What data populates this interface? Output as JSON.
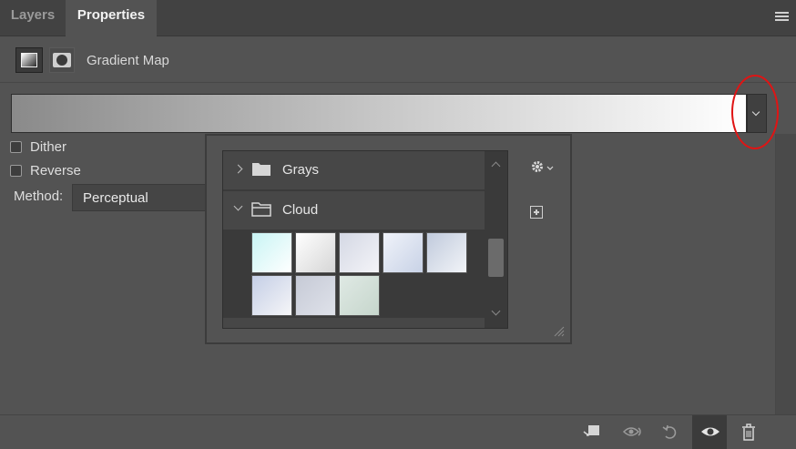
{
  "tabs": {
    "layers": "Layers",
    "properties": "Properties"
  },
  "header": {
    "title": "Gradient Map"
  },
  "options": {
    "dither": "Dither",
    "reverse": "Reverse",
    "method_label": "Method:",
    "method_value": "Perceptual"
  },
  "gradient_bar": {
    "stops": [
      "#8a8a8a",
      "#c7c7c7",
      "#ffffff"
    ]
  },
  "preset_popup": {
    "groups": [
      {
        "name": "Grays",
        "expanded": false
      },
      {
        "name": "Cloud",
        "expanded": true
      }
    ],
    "cloud_swatches": [
      {
        "from": "#c8f4f4",
        "to": "#ffffff"
      },
      {
        "from": "#ffffff",
        "to": "#d6d6d6"
      },
      {
        "from": "#d4d8e4",
        "to": "#f4f4f8"
      },
      {
        "from": "#f0f3fa",
        "to": "#c8d2e6"
      },
      {
        "from": "#c0cadc",
        "to": "#f2f4f8"
      },
      {
        "from": "#c4cee6",
        "to": "#f6f6f8"
      },
      {
        "from": "#c6cad6",
        "to": "#dfe2ea"
      },
      {
        "from": "#dfe9e4",
        "to": "#c6d6cc"
      }
    ]
  },
  "colors": {
    "panel_bg": "#535353",
    "annotation": "#e01414"
  }
}
